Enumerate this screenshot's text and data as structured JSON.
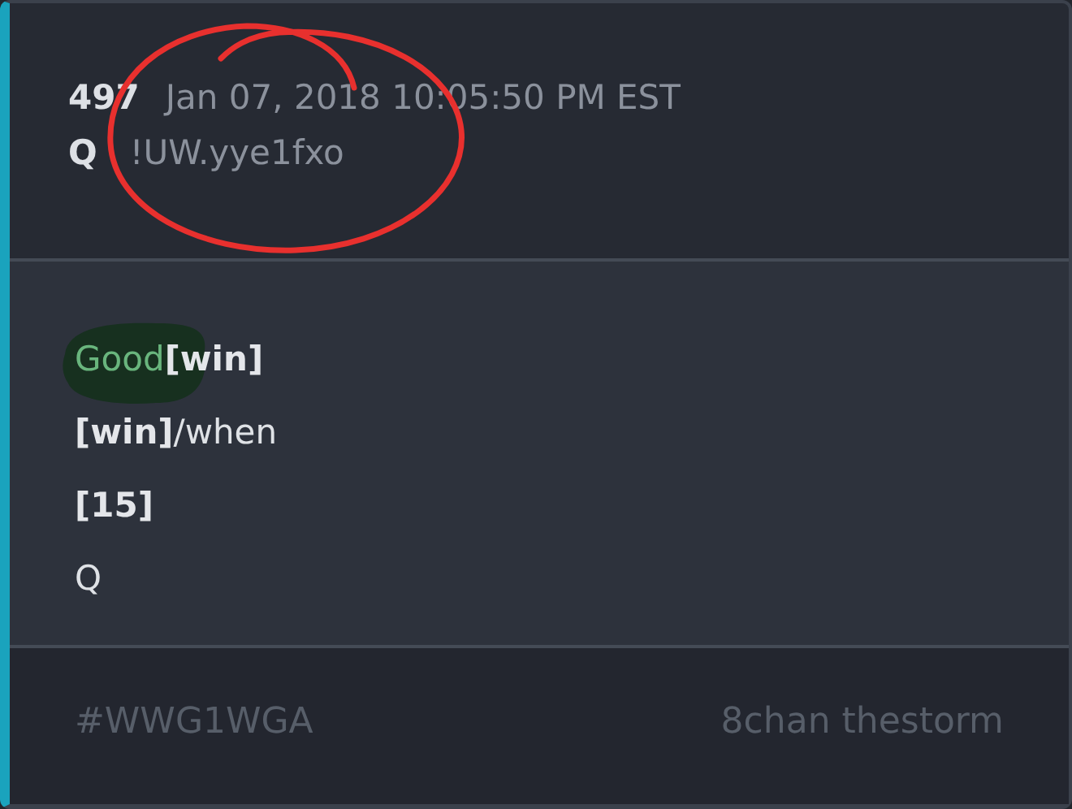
{
  "post": {
    "number": "497",
    "timestamp": "Jan 07, 2018 10:05:50 PM EST",
    "author": "Q",
    "tripcode": "!UW.yye1fxo",
    "lines": [
      [
        {
          "text": "Good",
          "kind": "greentext"
        },
        {
          "text": "[win]",
          "kind": "bold"
        }
      ],
      [
        {
          "text": "[win]",
          "kind": "bold"
        },
        {
          "text": "/when",
          "kind": "plain"
        }
      ],
      [
        {
          "text": "[15]",
          "kind": "bold"
        }
      ],
      [
        {
          "text": "Q",
          "kind": "plain"
        }
      ]
    ],
    "hashtag": "#WWG1WGA",
    "source": "8chan thestorm"
  },
  "annotations": {
    "scribble": true,
    "circle": true
  }
}
